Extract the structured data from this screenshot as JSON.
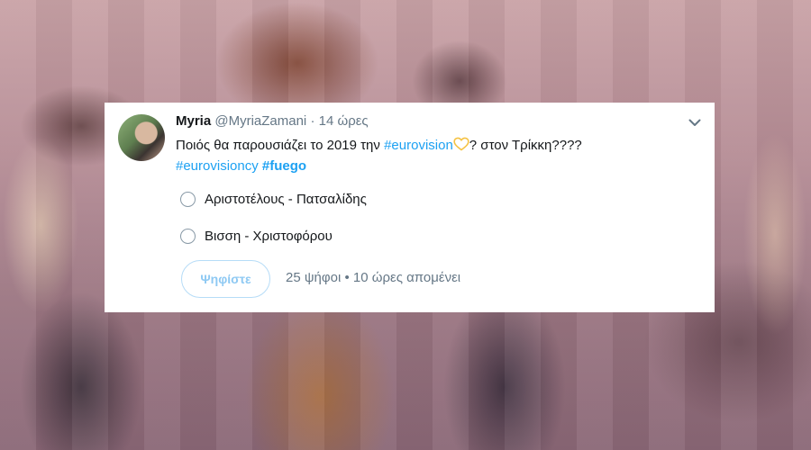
{
  "tweet": {
    "name": "Myria",
    "handle": "@MyriaZamani",
    "separator": "·",
    "time": "14 ώρες",
    "text_line1": "Ποιός θα παρουσιάζει το 2019 την ",
    "hashtag_eurovision": "#eurovision",
    "text_after_heart": "? στον Τρίκκη????",
    "hashtag_eurovisioncy": "#eurovisioncy",
    "hashtag_fuego": "#fuego",
    "heart_color": "#f5c242",
    "link_color": "#1da1f2"
  },
  "poll": {
    "options": [
      "Αριστοτέλους - Πατσαλίδης",
      "Βισση - Χριστοφόρου"
    ],
    "vote_label": "Ψηφίστε",
    "votes": "25 ψήφοι",
    "dot": "•",
    "remaining": "10 ώρες απομένει"
  }
}
